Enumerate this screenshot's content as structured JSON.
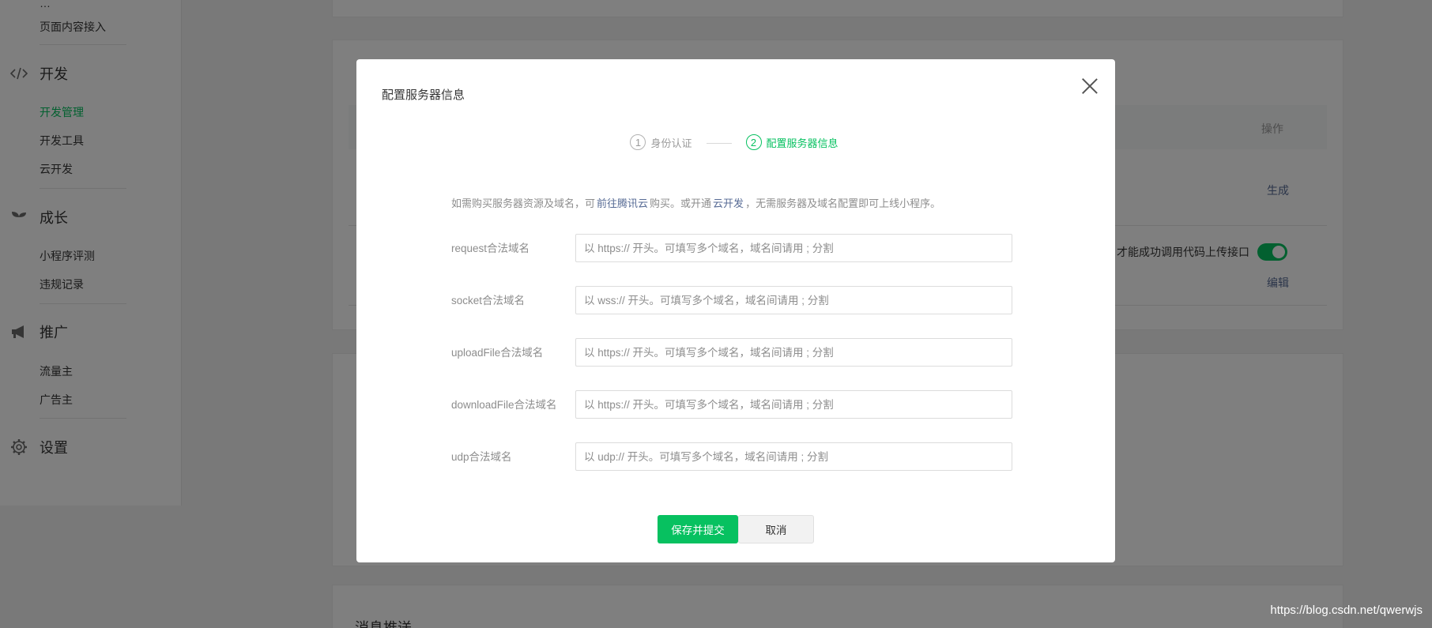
{
  "sidebar": {
    "item_top": "页面内容接入",
    "groups": {
      "develop": {
        "label": "开发",
        "icon": "code-icon",
        "items": [
          "开发管理",
          "开发工具",
          "云开发"
        ]
      },
      "growth": {
        "label": "成长",
        "icon": "sprout-icon",
        "items": [
          "小程序评测",
          "违规记录"
        ]
      },
      "promote": {
        "label": "推广",
        "icon": "megaphone-icon",
        "items": [
          "流量主",
          "广告主"
        ]
      },
      "settings": {
        "label": "设置",
        "icon": "gear-icon"
      }
    },
    "active_item": "开发管理"
  },
  "background": {
    "table_op_header": "操作",
    "generate_link": "生成",
    "row_text": "才能成功调用代码上传接口",
    "edit_link": "编辑",
    "section_title": "消息推送"
  },
  "dialog": {
    "title": "配置服务器信息",
    "steps": [
      {
        "num": "1",
        "label": "身份认证",
        "active": false
      },
      {
        "num": "2",
        "label": "配置服务器信息",
        "active": true
      }
    ],
    "notice": {
      "part1": "如需购买服务器资源及域名，可",
      "link1": "前往腾讯云",
      "part2": "购买。或开通",
      "link2": "云开发",
      "part3": "，无需服务器及域名配置即可上线小程序。"
    },
    "fields": [
      {
        "label": "request合法域名",
        "placeholder": "以 https:// 开头。可填写多个域名，域名间请用 ; 分割"
      },
      {
        "label": "socket合法域名",
        "placeholder": "以 wss:// 开头。可填写多个域名，域名间请用 ; 分割"
      },
      {
        "label": "uploadFile合法域名",
        "placeholder": "以 https:// 开头。可填写多个域名，域名间请用 ; 分割"
      },
      {
        "label": "downloadFile合法域名",
        "placeholder": "以 https:// 开头。可填写多个域名，域名间请用 ; 分割"
      },
      {
        "label": "udp合法域名",
        "placeholder": "以 udp:// 开头。可填写多个域名，域名间请用 ; 分割"
      }
    ],
    "save_label": "保存并提交",
    "cancel_label": "取消"
  },
  "watermark": "https://blog.csdn.net/qwerwjs",
  "colors": {
    "brand_green": "#07c160",
    "link_blue": "#576b95"
  }
}
